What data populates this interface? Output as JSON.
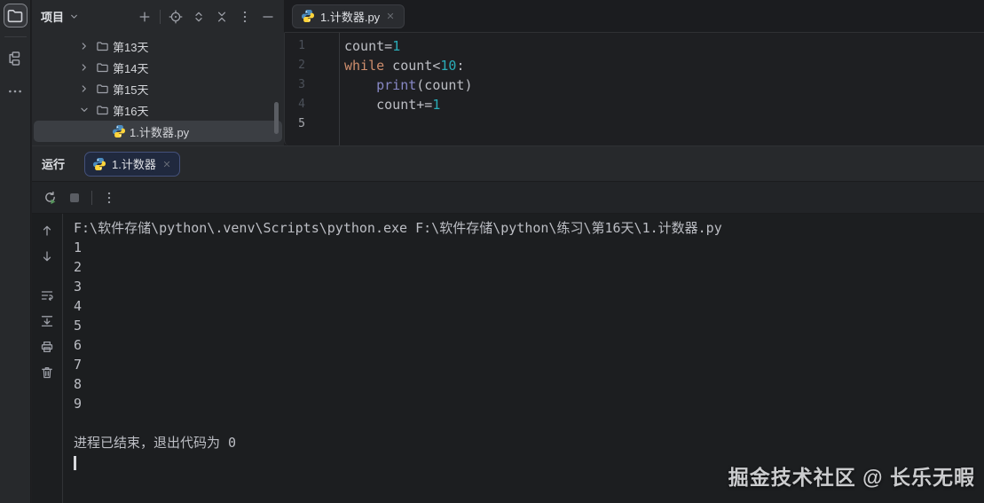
{
  "stripe": {
    "buttons": [
      {
        "icon": "project-folder",
        "name": "project-tool-button",
        "active": true
      },
      {
        "icon": "structure",
        "name": "structure-tool-button",
        "active": false
      },
      {
        "icon": "more-h",
        "name": "more-tool-windows-button",
        "active": false
      }
    ]
  },
  "project_panel": {
    "title": "项目",
    "header_icons": [
      "plus",
      "sep",
      "target",
      "expand-all",
      "collapse-all",
      "kebab",
      "minus"
    ],
    "tree": [
      {
        "label": "第13天",
        "type": "folder",
        "state": "collapsed",
        "selected": false
      },
      {
        "label": "第14天",
        "type": "folder",
        "state": "collapsed",
        "selected": false
      },
      {
        "label": "第15天",
        "type": "folder",
        "state": "collapsed",
        "selected": false
      },
      {
        "label": "第16天",
        "type": "folder",
        "state": "expanded",
        "selected": false
      },
      {
        "label": "1.计数器.py",
        "type": "python-file",
        "state": null,
        "selected": true
      }
    ]
  },
  "editor": {
    "tab": {
      "label": "1.计数器.py",
      "icon": "python"
    },
    "lines": [
      {
        "num": "1",
        "current": false,
        "tokens": [
          [
            "count=",
            "text"
          ],
          [
            "1",
            "number"
          ]
        ]
      },
      {
        "num": "2",
        "current": false,
        "tokens": [
          [
            "while",
            "keyword"
          ],
          [
            " count<",
            "text"
          ],
          [
            "10",
            "number"
          ],
          [
            ":",
            "text"
          ]
        ]
      },
      {
        "num": "3",
        "current": false,
        "tokens": [
          [
            "    ",
            "text"
          ],
          [
            "print",
            "builtin"
          ],
          [
            "(count)",
            "text"
          ]
        ]
      },
      {
        "num": "4",
        "current": false,
        "tokens": [
          [
            "    count+=",
            "text"
          ],
          [
            "1",
            "number"
          ]
        ]
      },
      {
        "num": "5",
        "current": true,
        "tokens": []
      }
    ]
  },
  "run_panel": {
    "title": "运行",
    "tab": {
      "label": "1.计数器",
      "icon": "python"
    },
    "toolbar_icons": [
      "rerun",
      "stop",
      "sep",
      "kebab"
    ],
    "console_toolbar_icons": [
      "arrow-up",
      "arrow-down",
      "gap",
      "soft-wrap",
      "scroll-end",
      "printer",
      "trash"
    ],
    "console": {
      "command": "F:\\软件存储\\python\\.venv\\Scripts\\python.exe F:\\软件存储\\python\\练习\\第16天\\1.计数器.py",
      "output_lines": [
        "1",
        "2",
        "3",
        "4",
        "5",
        "6",
        "7",
        "8",
        "9"
      ],
      "status_line": "进程已结束，退出代码为 0"
    }
  },
  "watermark": "掘金技术社区 @ 长乐无暇",
  "colors": {
    "text": "#BCBEC4",
    "keyword": "#CF8E6D",
    "number": "#2AACB8",
    "builtin": "#8888C6",
    "run_tab_bg": "#20293E",
    "run_tab_border": "#44517A",
    "python_blue": "#4B8BBE",
    "python_yellow": "#FFD43B",
    "play_green": "#57965C"
  }
}
